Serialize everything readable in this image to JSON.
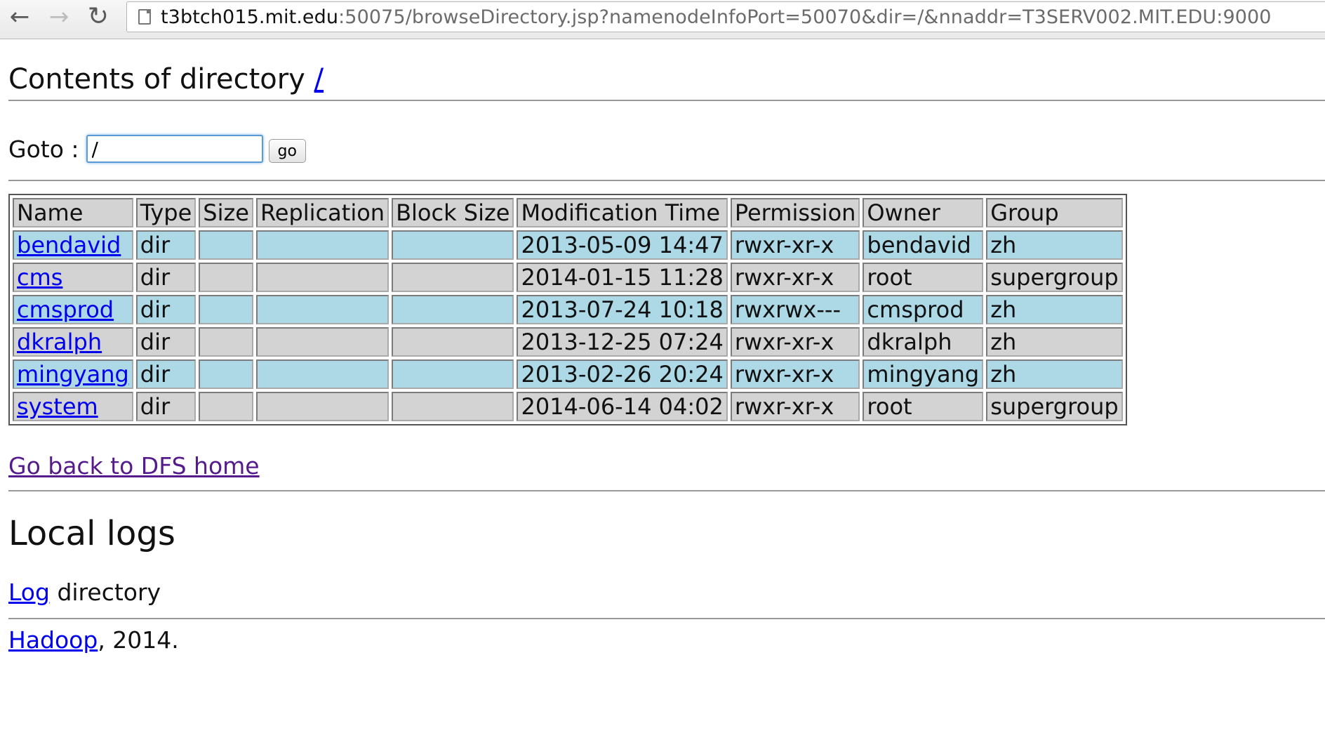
{
  "browser": {
    "url_host": "t3btch015.mit.edu",
    "url_rest": ":50075/browseDirectory.jsp?namenodeInfoPort=50070&dir=/&nnaddr=T3SERV002.MIT.EDU:9000"
  },
  "header": {
    "title_prefix": "Contents of directory",
    "dir_link": "/"
  },
  "goto": {
    "label": "Goto :",
    "value": "/",
    "button": "go"
  },
  "table": {
    "columns": [
      "Name",
      "Type",
      "Size",
      "Replication",
      "Block Size",
      "Modification Time",
      "Permission",
      "Owner",
      "Group"
    ],
    "rows": [
      {
        "name": "bendavid",
        "type": "dir",
        "size": "",
        "replication": "",
        "block_size": "",
        "mtime": "2013-05-09 14:47",
        "permission": "rwxr-xr-x",
        "owner": "bendavid",
        "group": "zh"
      },
      {
        "name": "cms",
        "type": "dir",
        "size": "",
        "replication": "",
        "block_size": "",
        "mtime": "2014-01-15 11:28",
        "permission": "rwxr-xr-x",
        "owner": "root",
        "group": "supergroup"
      },
      {
        "name": "cmsprod",
        "type": "dir",
        "size": "",
        "replication": "",
        "block_size": "",
        "mtime": "2013-07-24 10:18",
        "permission": "rwxrwx---",
        "owner": "cmsprod",
        "group": "zh"
      },
      {
        "name": "dkralph",
        "type": "dir",
        "size": "",
        "replication": "",
        "block_size": "",
        "mtime": "2013-12-25 07:24",
        "permission": "rwxr-xr-x",
        "owner": "dkralph",
        "group": "zh"
      },
      {
        "name": "mingyang",
        "type": "dir",
        "size": "",
        "replication": "",
        "block_size": "",
        "mtime": "2013-02-26 20:24",
        "permission": "rwxr-xr-x",
        "owner": "mingyang",
        "group": "zh"
      },
      {
        "name": "system",
        "type": "dir",
        "size": "",
        "replication": "",
        "block_size": "",
        "mtime": "2014-06-14 04:02",
        "permission": "rwxr-xr-x",
        "owner": "root",
        "group": "supergroup"
      }
    ]
  },
  "links": {
    "back_home": "Go back to DFS home"
  },
  "local_logs": {
    "heading": "Local logs",
    "log_link": "Log",
    "log_suffix": " directory"
  },
  "footer": {
    "hadoop_link": "Hadoop",
    "suffix": ", 2014."
  },
  "colors": {
    "odd_row": "#add8e6",
    "even_row": "#d3d3d3",
    "link": "#0000ee",
    "visited_link": "#551a8b"
  }
}
